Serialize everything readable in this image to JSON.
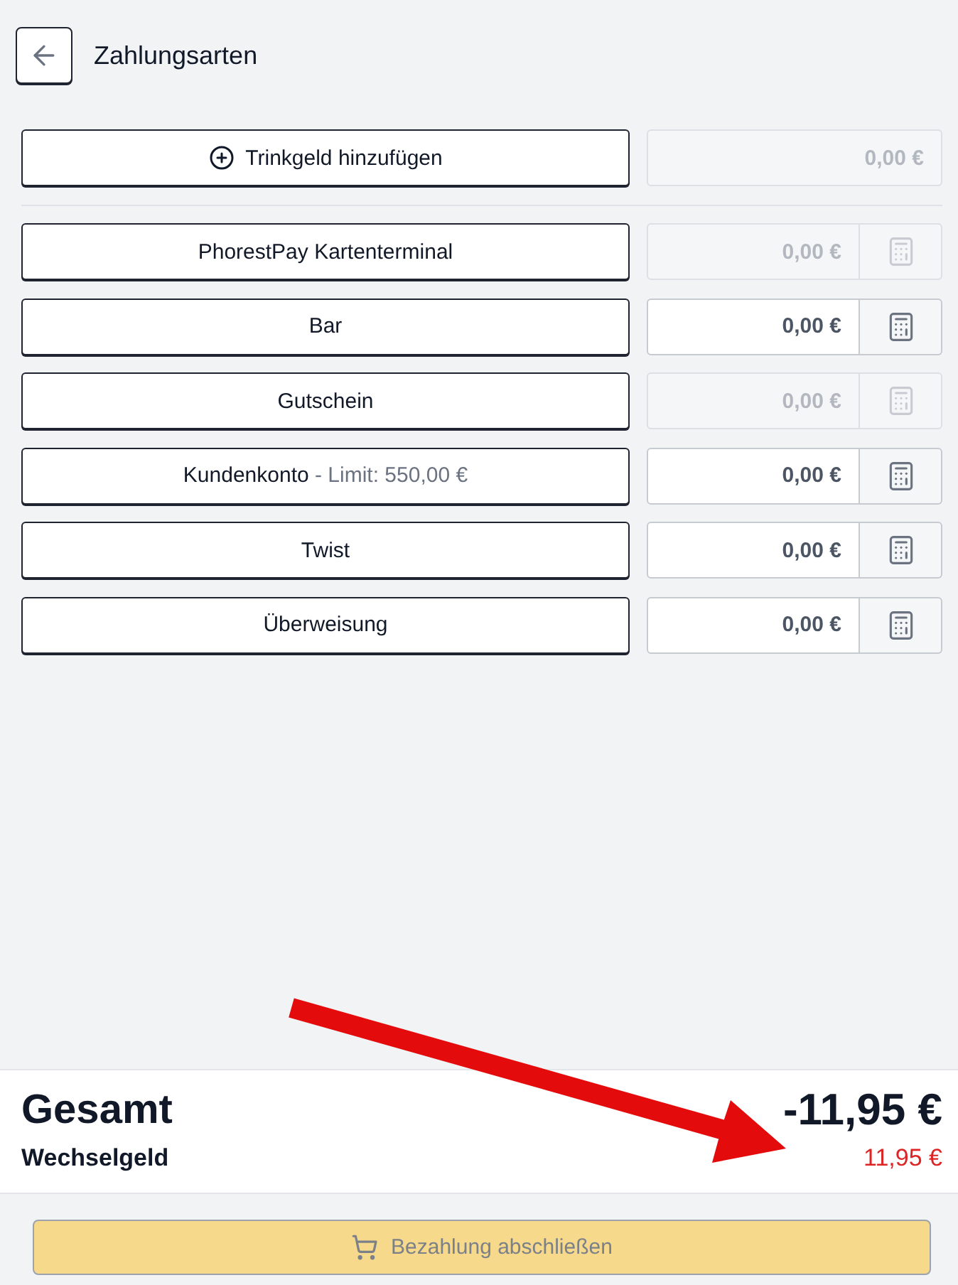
{
  "header": {
    "title": "Zahlungsarten"
  },
  "tip": {
    "label": "Trinkgeld hinzufügen",
    "amount": "0,00 €",
    "disabled": true
  },
  "payment_methods": [
    {
      "label": "PhorestPay Kartenterminal",
      "amount": "0,00 €",
      "disabled": true
    },
    {
      "label": "Bar",
      "amount": "0,00 €",
      "disabled": false
    },
    {
      "label": "Gutschein",
      "amount": "0,00 €",
      "disabled": true
    },
    {
      "label": "Kundenkonto",
      "note": "- Limit: 550,00 €",
      "amount": "0,00 €",
      "disabled": false
    },
    {
      "label": "Twist",
      "amount": "0,00 €",
      "disabled": false
    },
    {
      "label": "Überweisung",
      "amount": "0,00 €",
      "disabled": false
    }
  ],
  "summary": {
    "total_label": "Gesamt",
    "total": "-11,95 €",
    "change_label": "Wechselgeld",
    "change": "11,95 €"
  },
  "checkout_button": {
    "label": "Bezahlung abschließen",
    "disabled": true
  },
  "annotations": [
    {
      "kind": "arrow"
    }
  ]
}
